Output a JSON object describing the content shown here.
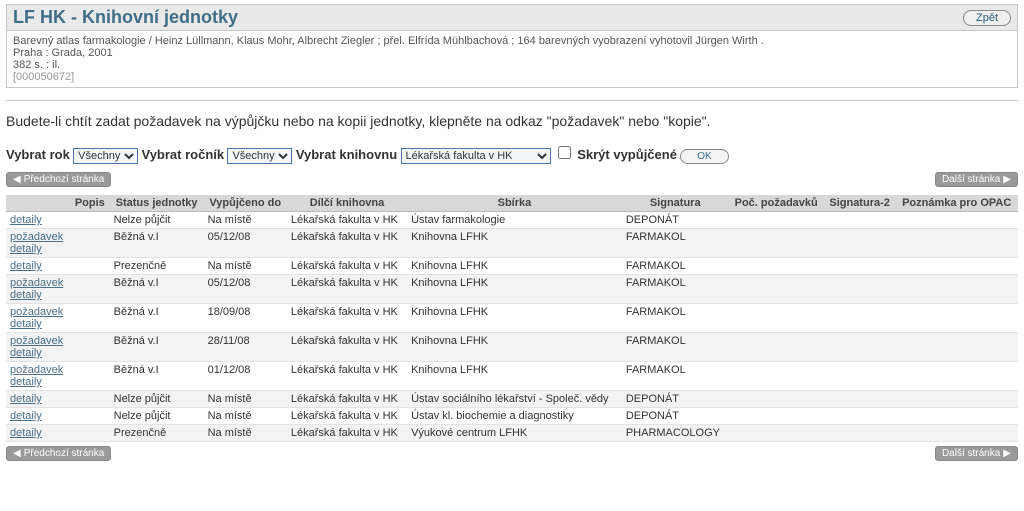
{
  "header": {
    "title": "LF HK - Knihovní jednotky",
    "back": "Zpět"
  },
  "citation": {
    "line1": "Barevný atlas farmakologie / Heinz Lüllmann, Klaus Mohr, Albrecht Ziegler ; přel. Elfrída Mühlbachová ; 164 barevných vyobrazení vyhotovil Jürgen Wirth .",
    "line2": "Praha : Grada, 2001",
    "line3": "382 s. : il.",
    "sys": "[000050672]"
  },
  "instruction": "Budete-li chtít zadat požadavek na výpůjčku nebo na kopii jednotky, klepněte na odkaz \"požadavek\" nebo \"kopie\".",
  "filters": {
    "year_label": "Vybrat rok",
    "year_value": "Všechny",
    "volume_label": "Vybrat ročník",
    "volume_value": "Všechny",
    "lib_label": "Vybrat knihovnu",
    "lib_value": "Lékařská fakulta v HK",
    "hide_label": "Skrýt vypůjčené",
    "ok": "OK"
  },
  "nav": {
    "prev": "Předchozí stránka",
    "next": "Další stránka"
  },
  "labels": {
    "request": "požadavek",
    "details": "detaily"
  },
  "columns": [
    "",
    "Popis",
    "Status jednotky",
    "Vypůjčeno do",
    "Dílčí knihovna",
    "Sbírka",
    "Signatura",
    "Poč. požadavků",
    "Signatura-2",
    "Poznámka pro OPAC"
  ],
  "rows": [
    {
      "req": false,
      "status": "Nelze půjčit",
      "due": "Na místě",
      "lib": "Lékařská fakulta v HK",
      "coll": "Ústav farmakologie",
      "sig": "DEPONÁT"
    },
    {
      "req": true,
      "status": "Běžná v.I",
      "due": "05/12/08",
      "lib": "Lékařská fakulta v HK",
      "coll": "Knihovna LFHK",
      "sig": "FARMAKOL"
    },
    {
      "req": false,
      "status": "Prezenčně",
      "due": "Na místě",
      "lib": "Lékařská fakulta v HK",
      "coll": "Knihovna LFHK",
      "sig": "FARMAKOL"
    },
    {
      "req": true,
      "status": "Běžná v.I",
      "due": "05/12/08",
      "lib": "Lékařská fakulta v HK",
      "coll": "Knihovna LFHK",
      "sig": "FARMAKOL"
    },
    {
      "req": true,
      "status": "Běžná v.I",
      "due": "18/09/08",
      "lib": "Lékařská fakulta v HK",
      "coll": "Knihovna LFHK",
      "sig": "FARMAKOL"
    },
    {
      "req": true,
      "status": "Běžná v.I",
      "due": "28/11/08",
      "lib": "Lékařská fakulta v HK",
      "coll": "Knihovna LFHK",
      "sig": "FARMAKOL"
    },
    {
      "req": true,
      "status": "Běžná v.I",
      "due": "01/12/08",
      "lib": "Lékařská fakulta v HK",
      "coll": "Knihovna LFHK",
      "sig": "FARMAKOL"
    },
    {
      "req": false,
      "status": "Nelze půjčit",
      "due": "Na místě",
      "lib": "Lékařská fakulta v HK",
      "coll": "Ústav sociálního lékařství - Společ. vědy",
      "sig": "DEPONÁT"
    },
    {
      "req": false,
      "status": "Nelze půjčit",
      "due": "Na místě",
      "lib": "Lékařská fakulta v HK",
      "coll": "Ústav kl. biochemie a diagnostiky",
      "sig": "DEPONÁT"
    },
    {
      "req": false,
      "status": "Prezenčně",
      "due": "Na místě",
      "lib": "Lékařská fakulta v HK",
      "coll": "Výukové centrum LFHK",
      "sig": "PHARMACOLOGY"
    }
  ]
}
